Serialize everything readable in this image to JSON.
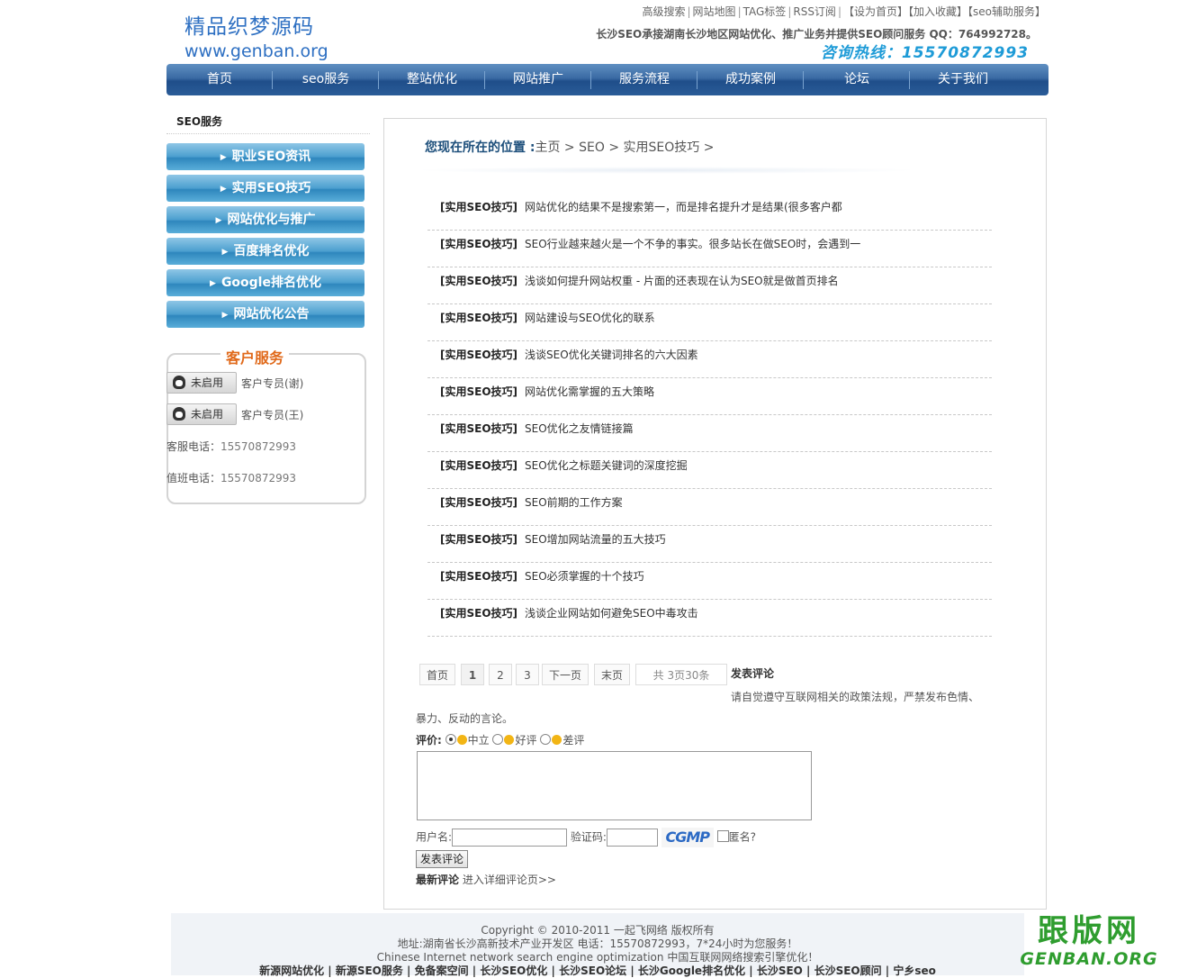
{
  "header": {
    "logo_cn": "精品织梦源码",
    "logo_en": "www.genban.org",
    "top_links": [
      "高级搜索",
      "网站地图",
      "TAG标签",
      "RSS订阅",
      "【设为首页】",
      "【加入收藏】",
      "【seo辅助服务】"
    ],
    "tagline": "长沙SEO承接湖南长沙地区网站优化、推广业务并提供SEO顾问服务 QQ：764992728。",
    "hotline": "咨询热线：15570872993"
  },
  "nav": [
    "首页",
    "seo服务",
    "整站优化",
    "网站推广",
    "服务流程",
    "成功案例",
    "论坛",
    "关于我们"
  ],
  "sidebar": {
    "title": "SEO服务",
    "items": [
      "职业SEO资讯",
      "实用SEO技巧",
      "网站优化与推广",
      "百度排名优化",
      "Google排名优化",
      "网站优化公告"
    ],
    "cs_title": "客户服务",
    "qq_status": "未启用",
    "agents": [
      "客户专员(谢)",
      "客户专员(王)"
    ],
    "phone1_label": "客服电话：",
    "phone1": "15570872993",
    "phone2_label": "值班电话：",
    "phone2": "15570872993"
  },
  "breadcrumb": {
    "label": "您现在所在的位置 :",
    "path": "主页 > SEO > 实用SEO技巧 >"
  },
  "articles": {
    "tag": "[实用SEO技巧]",
    "titles": [
      "网站优化的结果不是搜索第一，而是排名提升才是结果(很多客户都",
      "SEO行业越来越火是一个不争的事实。很多站长在做SEO时，会遇到一",
      "浅谈如何提升网站权重 - 片面的还表现在认为SEO就是做首页排名",
      "网站建设与SEO优化的联系",
      "浅谈SEO优化关键词排名的六大因素",
      "网站优化需掌握的五大策略",
      "SEO优化之友情链接篇",
      "SEO优化之标题关键词的深度挖掘",
      "SEO前期的工作方案",
      "SEO增加网站流量的五大技巧",
      "SEO必须掌握的十个技巧",
      "浅谈企业网站如何避免SEO中毒攻击"
    ]
  },
  "pagination": {
    "first": "首页",
    "pages": [
      "1",
      "2",
      "3"
    ],
    "next": "下一页",
    "last": "末页",
    "info": "共 3页30条",
    "current": "1"
  },
  "comment": {
    "heading": "发表评论",
    "rule_a": "请自觉遵守互联网相关的政策法规，严禁发布色情、",
    "rule_b": "暴力、反动的言论。",
    "rating_label": "评价:",
    "ratings": [
      "中立",
      "好评",
      "差评"
    ],
    "username_label": "用户名:",
    "captcha_label": "验证码:",
    "captcha_text": "CGMP",
    "anonymous_label": "匿名?",
    "submit": "发表评论",
    "latest_label": "最新评论",
    "latest_link": "进入详细评论页>>"
  },
  "footer": {
    "copyright": "Copyright © 2010-2011 一起飞网络 版权所有",
    "address": "地址:湖南省长沙高新技术产业开发区 电话：15570872993，7*24小时为您服务！",
    "english": "Chinese Internet network search engine optimization 中国互联网网络搜索引擎优化！",
    "links": "新源网站优化 | 新源SEO服务 | 免备案空间 | 长沙SEO优化 | 长沙SEO论坛 | 长沙Google排名优化 | 长沙SEO | 长沙SEO顾问 | 宁乡seo"
  },
  "watermark": {
    "cn": "跟版网",
    "en": "GENBAN.ORG"
  },
  "colors": {
    "nav": "#2a5c98",
    "sidebar_button": "#4b9fcf",
    "hotline": "#1e9bd7",
    "cs_title": "#e0691a",
    "watermark": "#2f9d2f"
  }
}
